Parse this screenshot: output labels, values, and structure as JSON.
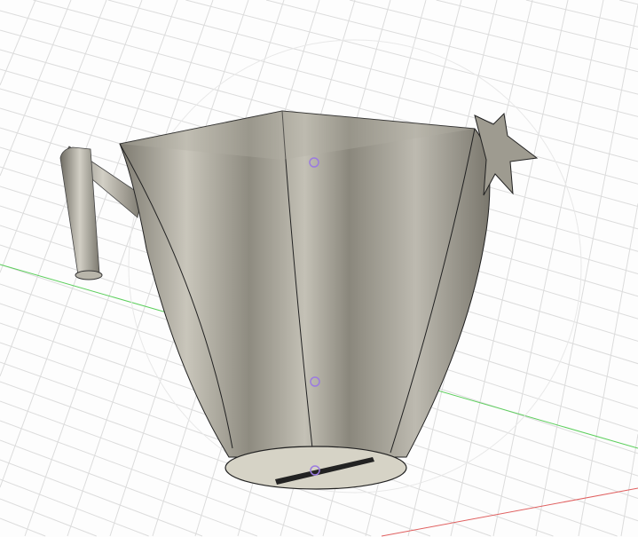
{
  "viewport": {
    "background": "#fdfdfd",
    "grid_color": "#d9d9d9",
    "x_axis_color": "#e06060",
    "y_axis_color": "#5ccf5c",
    "body_color": "#9c988c",
    "base_color": "#d6d3c6",
    "marker_color": "#9b7be0"
  },
  "model": {
    "name": "pitcher",
    "parts": [
      "body",
      "handle",
      "star",
      "base-engraving"
    ]
  }
}
